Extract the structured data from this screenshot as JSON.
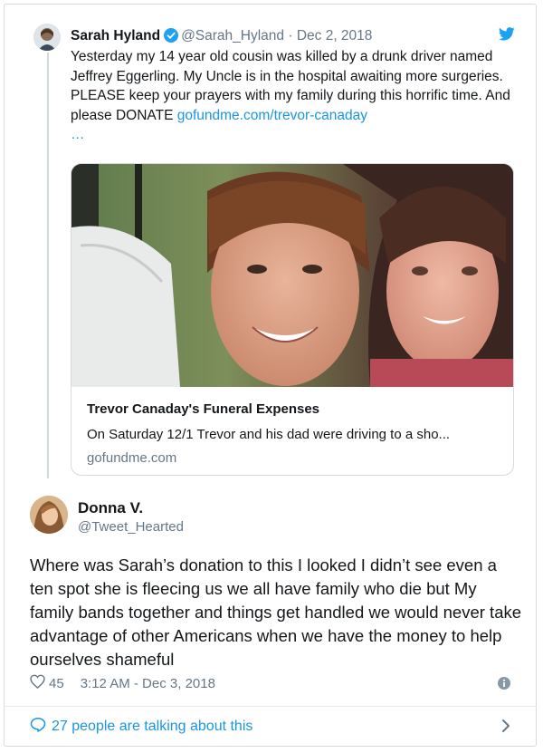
{
  "quoted_tweet": {
    "author_name": "Sarah Hyland",
    "handle": "@Sarah_Hyland",
    "separator": "·",
    "date": "Dec 2, 2018",
    "text": "Yesterday my 14 year old cousin was killed by a drunk driver named Jeffrey Eggerling. My Uncle is in the hospital awaiting more surgeries. PLEASE keep your prayers with my family during this horrific time. And please DONATE ",
    "link_text": "gofundme.com/trevor-canaday",
    "ellipsis": "…",
    "link_card": {
      "title": "Trevor Canaday's Funeral Expenses",
      "description": "On Saturday 12/1 Trevor and his dad were driving to a sho...",
      "domain": "gofundme.com"
    }
  },
  "main_tweet": {
    "author_name": "Donna V.",
    "handle": "@Tweet_Hearted",
    "text": "Where was Sarah’s donation to this I looked I didn’t see even a ten spot she is fleecing us we all have family who die but My family bands together and things get handled  we would never take advantage of other Americans when we have the money to help ourselves shameful",
    "likes": "45",
    "timestamp": "3:12 AM - Dec 3, 2018"
  },
  "footer": {
    "talking_text": "27 people are talking about this"
  },
  "colors": {
    "link": "#1b95e0",
    "secondary_text": "#657786",
    "border": "#d6dbdf"
  },
  "icons": [
    "verified-badge-icon",
    "twitter-bird-icon",
    "heart-icon",
    "info-icon",
    "speech-bubble-icon",
    "chevron-right-icon"
  ]
}
